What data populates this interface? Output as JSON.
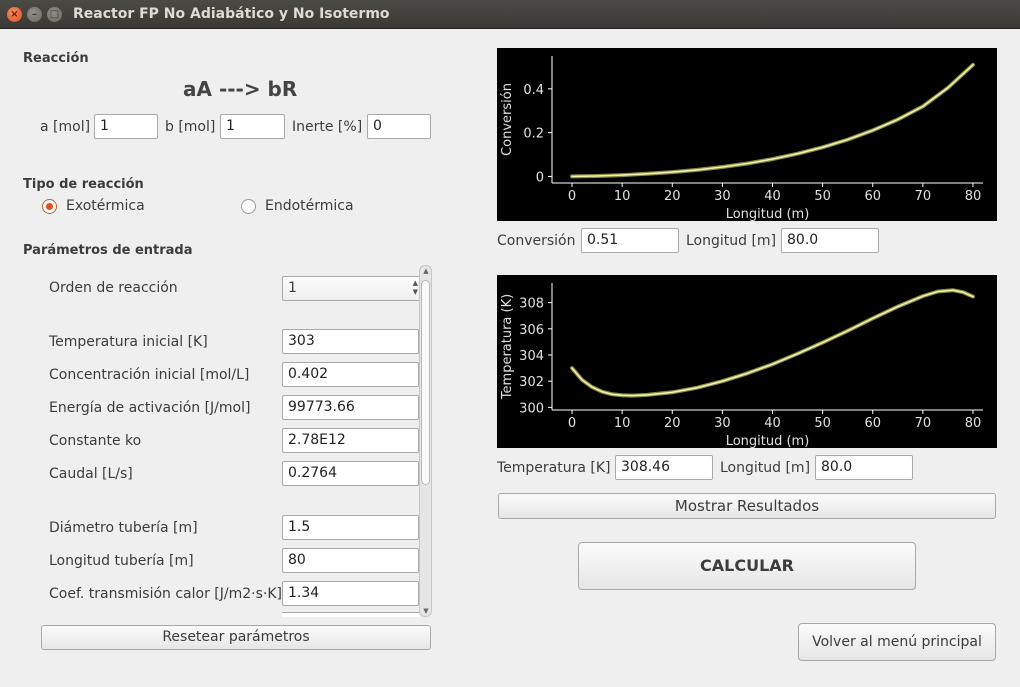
{
  "window": {
    "title": "Reactor FP No Adiabático y No Isotermo"
  },
  "reaction": {
    "section_label": "Reacción",
    "equation": "aA ---> bR",
    "a_label": "a [mol]",
    "a_value": "1",
    "b_label": "b [mol]",
    "b_value": "1",
    "inert_label": "Inerte [%]",
    "inert_value": "0"
  },
  "reaction_type": {
    "section_label": "Tipo de reacción",
    "exothermic_label": "Exotérmica",
    "endothermic_label": "Endotérmica",
    "selected": "Exotérmica"
  },
  "params": {
    "section_label": "Parámetros de entrada",
    "order_label": "Orden de reacción",
    "order_value": "1",
    "temp_label": "Temperatura inicial [K]",
    "temp_value": "303",
    "conc_label": "Concentración inicial [mol/L]",
    "conc_value": "0.402",
    "energy_label": "Energía de activación [J/mol]",
    "energy_value": "99773.66",
    "ko_label": "Constante ko",
    "ko_value": "2.78E12",
    "flow_label": "Caudal [L/s]",
    "flow_value": "0.2764",
    "diam_label": "Diámetro tubería [m]",
    "diam_value": "1.5",
    "length_label": "Longitud tubería [m]",
    "length_value": "80",
    "coef_label": "Coef. transmisión calor [J/m2·s·K]",
    "coef_value": "1.34",
    "reset_label": "Resetear parámetros"
  },
  "conversion_readout": {
    "conv_label": "Conversión",
    "conv_value": "0.51",
    "len_label": "Longitud [m]",
    "len_value": "80.0"
  },
  "temperature_readout": {
    "temp_label": "Temperatura [K]",
    "temp_value": "308.46",
    "len_label": "Longitud [m]",
    "len_value": "80.0"
  },
  "buttons": {
    "show_results": "Mostrar Resultados",
    "calculate": "CALCULAR",
    "back": "Volver al menú principal"
  },
  "colors": {
    "accent": "#e2501e",
    "plot_bg": "#000000",
    "curve": "#f2f2b0",
    "axis": "#ffffff"
  },
  "chart_data": [
    {
      "type": "line",
      "xlabel": "Longitud (m)",
      "ylabel": "Conversión",
      "xlim": [
        -4,
        82
      ],
      "ylim": [
        -0.03,
        0.55
      ],
      "xticks": [
        0,
        10,
        20,
        30,
        40,
        50,
        60,
        70,
        80
      ],
      "yticks": [
        0,
        0.2,
        0.4
      ],
      "ytick_labels": [
        "0",
        "0.2",
        "0.4"
      ],
      "grid": false,
      "x": [
        0,
        5,
        10,
        15,
        20,
        25,
        30,
        35,
        40,
        45,
        50,
        55,
        60,
        65,
        70,
        75,
        80
      ],
      "y": [
        0,
        0.002,
        0.006,
        0.012,
        0.02,
        0.03,
        0.043,
        0.059,
        0.079,
        0.104,
        0.133,
        0.168,
        0.21,
        0.26,
        0.32,
        0.405,
        0.51
      ]
    },
    {
      "type": "line",
      "xlabel": "Longitud (m)",
      "ylabel": "Temperatura (K)",
      "xlim": [
        -4,
        82
      ],
      "ylim": [
        299.8,
        309.5
      ],
      "xticks": [
        0,
        10,
        20,
        30,
        40,
        50,
        60,
        70,
        80
      ],
      "yticks": [
        300,
        302,
        304,
        306,
        308
      ],
      "ytick_labels": [
        "300",
        "302",
        "304",
        "306",
        "308"
      ],
      "grid": false,
      "x": [
        0,
        2,
        4,
        6,
        8,
        10,
        12,
        15,
        20,
        25,
        30,
        35,
        40,
        45,
        50,
        55,
        60,
        65,
        70,
        73,
        76,
        78,
        80
      ],
      "y": [
        303.0,
        302.1,
        301.55,
        301.2,
        301.0,
        300.92,
        300.9,
        300.95,
        301.15,
        301.5,
        302.0,
        302.6,
        303.3,
        304.1,
        304.95,
        305.85,
        306.8,
        307.7,
        308.5,
        308.85,
        308.95,
        308.8,
        308.46
      ]
    }
  ]
}
